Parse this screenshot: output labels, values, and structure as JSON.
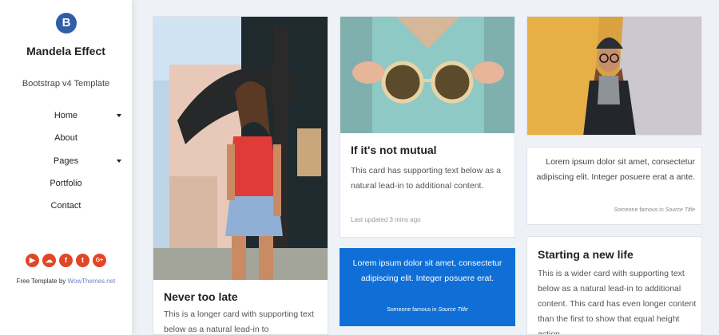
{
  "brand": {
    "logo_letter": "B",
    "title": "Mandela Effect",
    "subtitle": "Bootstrap v4 Template"
  },
  "nav": {
    "items": [
      {
        "label": "Home",
        "has_dropdown": true
      },
      {
        "label": "About",
        "has_dropdown": false
      },
      {
        "label": "Pages",
        "has_dropdown": true
      },
      {
        "label": "Portfolio",
        "has_dropdown": false
      },
      {
        "label": "Contact",
        "has_dropdown": false
      }
    ]
  },
  "social": {
    "icons": [
      "youtube-icon",
      "soundcloud-icon",
      "facebook-icon",
      "twitter-icon",
      "google-plus-icon"
    ],
    "glyphs": [
      "▶",
      "☁",
      "f",
      "t",
      "G+"
    ],
    "color": "#e14727"
  },
  "credit": {
    "prefix": "Free Template by ",
    "link": "WowThemes.net"
  },
  "cards": {
    "never": {
      "title": "Never too late",
      "text": "This is a longer card with supporting text below as a natural lead-in to"
    },
    "mutual": {
      "title": "If it's not mutual",
      "text": "This card has supporting text below as a natural lead-in to additional content.",
      "updated": "Last updated 3 mins ago"
    },
    "blue_quote": {
      "text": "Lorem ipsum dolor sit amet, consectetur adipiscing elit. Integer posuere erat.",
      "footer_prefix": "Someone famous in ",
      "footer_source": "Source Title",
      "bg_color": "#0f6fd6"
    },
    "white_quote": {
      "text": "Lorem ipsum dolor sit amet, consectetur adipiscing elit. Integer posuere erat a ante.",
      "footer_prefix": "Someone famous in ",
      "footer_source": "Source Title"
    },
    "new_life": {
      "title": "Starting a new life",
      "text": "This is a wider card with supporting text below as a natural lead-in to additional content. This card has even longer content than the first to show that equal height action."
    }
  }
}
